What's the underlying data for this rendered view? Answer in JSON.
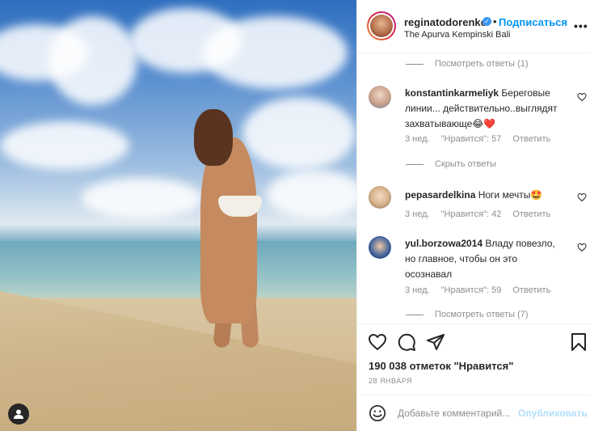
{
  "header": {
    "username": "reginatodorenko",
    "verified_mark": "✓",
    "separator": "•",
    "follow_label": "Подписаться",
    "location": "The Apurva Kempinski Bali",
    "more_label": "•••"
  },
  "replies_top": {
    "label": "Посмотреть ответы (1)"
  },
  "comments": [
    {
      "username": "konstantinkarmeliyk",
      "text": "Береговые линии... действительно..выглядят захватывающе😂❤️",
      "time": "3 нед.",
      "likes": "\"Нравится\": 57",
      "reply": "Ответить"
    },
    {
      "username": "pepasardelkina",
      "text": "Ноги мечты🤩",
      "time": "3 нед.",
      "likes": "\"Нравится\": 42",
      "reply": "Ответить"
    },
    {
      "username": "yul.borzowa2014",
      "text": "Владу повезло, но главное, чтобы он это осознавал",
      "time": "3 нед.",
      "likes": "\"Нравится\": 59",
      "reply": "Ответить"
    }
  ],
  "hide_replies": {
    "label": "Скрыть ответы"
  },
  "replies_bottom": {
    "label": "Посмотреть ответы (7)"
  },
  "post": {
    "likes_count": "190 038 отметок \"Нравится\"",
    "date": "28 ЯНВАРЯ"
  },
  "comment_box": {
    "placeholder": "Добавьте комментарий...",
    "post_label": "Опубликовать"
  },
  "icons": [
    "heart-icon",
    "comment-icon",
    "share-icon",
    "bookmark-icon",
    "emoji-icon",
    "user-tag-icon",
    "verified-icon",
    "more-icon"
  ],
  "colors": {
    "accent": "#0095f6",
    "muted": "#8e8e8e",
    "text": "#262626",
    "border": "#efefef"
  }
}
